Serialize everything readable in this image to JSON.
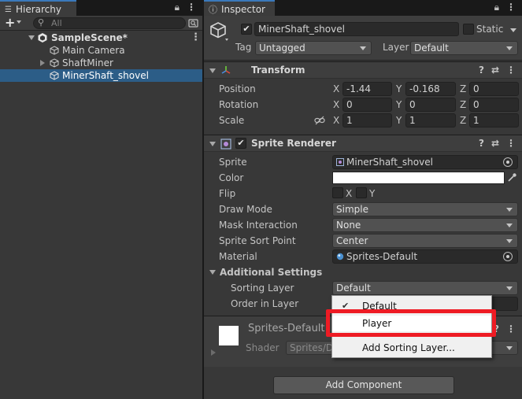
{
  "hierarchy": {
    "tab_label": "Hierarchy",
    "search_placeholder": "All",
    "items": [
      {
        "label": "SampleScene*"
      },
      {
        "label": "Main Camera"
      },
      {
        "label": "ShaftMiner"
      },
      {
        "label": "MinerShaft_shovel"
      }
    ]
  },
  "inspector": {
    "tab_label": "Inspector",
    "object_name": "MinerShaft_shovel",
    "static_label": "Static",
    "tag_label": "Tag",
    "tag_value": "Untagged",
    "layer_label": "Layer",
    "layer_value": "Default",
    "transform": {
      "title": "Transform",
      "position_label": "Position",
      "rotation_label": "Rotation",
      "scale_label": "Scale",
      "axis_x": "X",
      "axis_y": "Y",
      "axis_z": "Z",
      "position": {
        "x": "-1.44",
        "y": "-0.168",
        "z": "0"
      },
      "rotation": {
        "x": "0",
        "y": "0",
        "z": "0"
      },
      "scale": {
        "x": "1",
        "y": "1",
        "z": "1"
      }
    },
    "sprite_renderer": {
      "title": "Sprite Renderer",
      "sprite_label": "Sprite",
      "sprite_value": "MinerShaft_shovel",
      "color_label": "Color",
      "flip_label": "Flip",
      "flip_x": "X",
      "flip_y": "Y",
      "draw_mode_label": "Draw Mode",
      "draw_mode_value": "Simple",
      "mask_label": "Mask Interaction",
      "mask_value": "None",
      "sort_point_label": "Sprite Sort Point",
      "sort_point_value": "Center",
      "material_label": "Material",
      "material_value": "Sprites-Default",
      "additional_label": "Additional Settings",
      "sorting_layer_label": "Sorting Layer",
      "sorting_layer_value": "Default",
      "order_label": "Order in Layer"
    },
    "material_section": {
      "name": "Sprites-Default",
      "shader_label": "Shader",
      "shader_value": "Sprites/De"
    },
    "add_component_label": "Add Component"
  },
  "popup": {
    "items": [
      {
        "label": "Default",
        "checked": true
      },
      {
        "label": "Player",
        "checked": false
      },
      {
        "label": "Add Sorting Layer...",
        "checked": false
      }
    ]
  },
  "colors": {
    "selection": "#2c5d87",
    "highlight": "#ee1b24",
    "accent_tab": "#3a79bb"
  }
}
